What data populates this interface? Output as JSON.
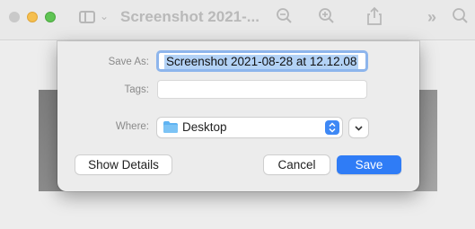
{
  "window": {
    "title": "Screenshot 2021-..."
  },
  "dialog": {
    "save_as_label": "Save As:",
    "save_as_value": "Screenshot 2021-08-28 at 12.12.08",
    "tags_label": "Tags:",
    "tags_value": "",
    "where_label": "Where:",
    "where_value": "Desktop",
    "show_details_label": "Show Details",
    "cancel_label": "Cancel",
    "save_label": "Save"
  },
  "toolbar": {
    "icons": [
      "sidebar-icon",
      "chevron-down-icon",
      "zoom-out-icon",
      "zoom-in-icon",
      "share-icon",
      "more-icon",
      "search-icon"
    ]
  },
  "colors": {
    "accent": "#2f7cf6",
    "selection": "#b3d2f6",
    "focus_ring": "#8db5ec",
    "minimize": "#f5bf4f",
    "maximize": "#5fc454"
  }
}
